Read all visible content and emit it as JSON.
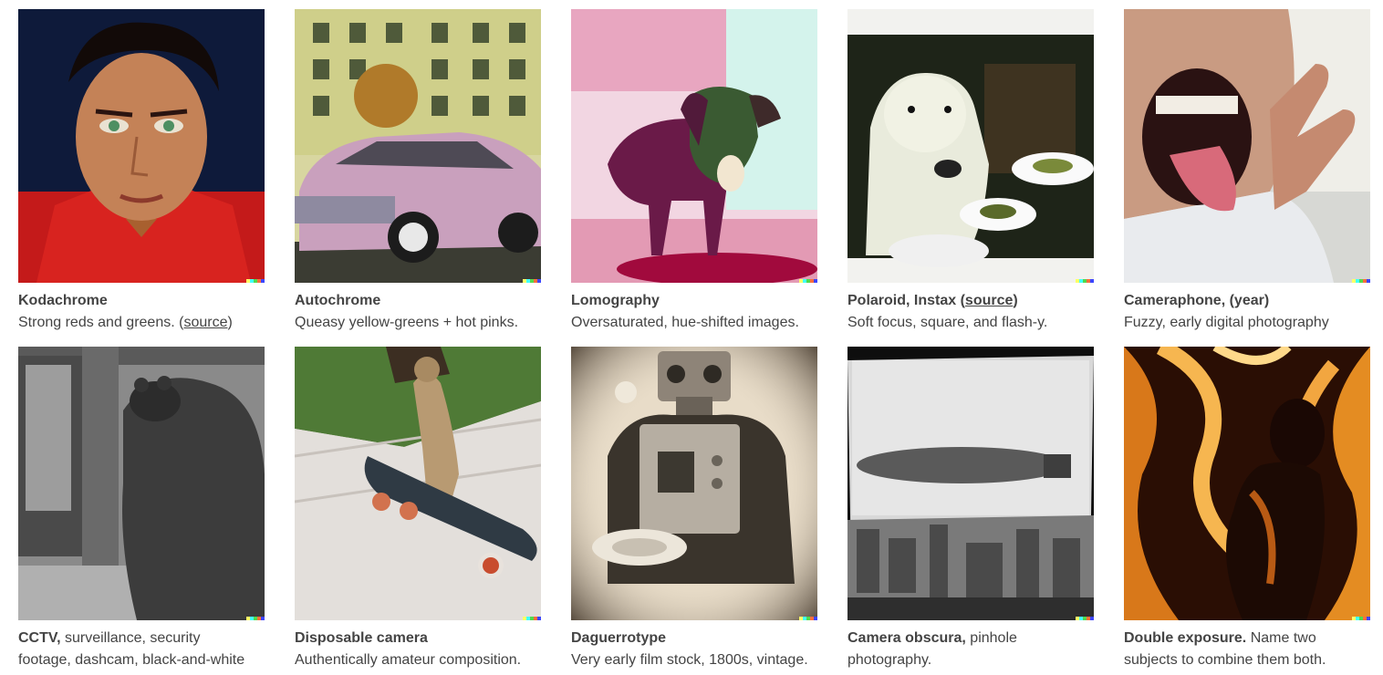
{
  "cards": [
    {
      "title": "Kodachrome",
      "desc_pre": "Strong reds and greens. (",
      "link": "source",
      "desc_post": ")",
      "image": "portrait-boy-red-shirt"
    },
    {
      "title": "Autochrome",
      "desc": "Queasy yellow-greens + hot pinks.",
      "image": "pink-cadillac-street"
    },
    {
      "title": "Lomography",
      "desc": "Oversaturated, hue-shifted images.",
      "image": "dog-on-sidewalk"
    },
    {
      "title_pre": "Polaroid, Instax (",
      "link": "source",
      "title_post": ")",
      "desc": "Soft focus, square, and flash-y.",
      "image": "polar-bear-dinner"
    },
    {
      "title": "Cameraphone, (year)",
      "desc": "Fuzzy, early digital photography",
      "image": "selfie-tongue"
    },
    {
      "title": "CCTV,",
      "title_rest": " surveillance, security",
      "desc": "footage, dashcam, black-and-white",
      "image": "bear-cctv"
    },
    {
      "title": "Disposable camera",
      "desc": "Authentically amateur composition.",
      "image": "meerkat-skateboard"
    },
    {
      "title": "Daguerrotype",
      "desc": "Very early film stock, 1800s, vintage.",
      "image": "robot-drinking-coffee"
    },
    {
      "title": "Camera obscura,",
      "title_rest": " pinhole",
      "desc": "photography.",
      "image": "zeppelin-city"
    },
    {
      "title": "Double exposure.",
      "title_rest": " Name two",
      "desc": "subjects to combine them both.",
      "image": "silhouette-fire"
    }
  ],
  "dalle_mark_colors": [
    "#ffff66",
    "#42ffff",
    "#51da4c",
    "#ff6e3c",
    "#3c46ff"
  ]
}
